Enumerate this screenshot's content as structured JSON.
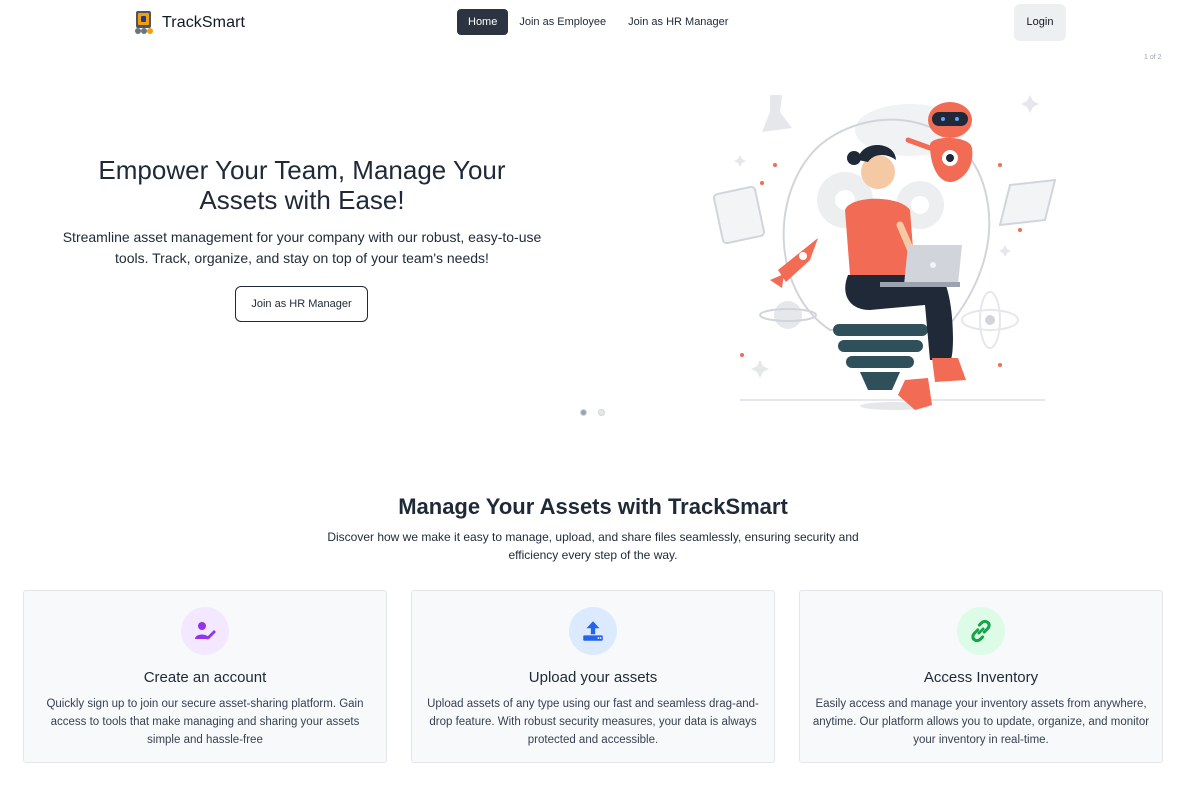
{
  "nav": {
    "brand": "TrackSmart",
    "links": [
      "Home",
      "Join as Employee",
      "Join as HR Manager"
    ],
    "login": "Login"
  },
  "hero": {
    "counter": "1 of 2",
    "title": "Empower Your Team, Manage Your Assets with Ease!",
    "subtitle": "Streamline asset management for your company with our robust, easy-to-use tools. Track, organize, and stay on top of your team's needs!",
    "cta": "Join as HR Manager",
    "illustration": "woman-on-lightbulb-with-robot-illustration"
  },
  "features": {
    "title": "Manage Your Assets with TrackSmart",
    "subtitle": "Discover how we make it easy to manage, upload, and share files seamlessly, ensuring security and efficiency every step of the way.",
    "cards": [
      {
        "icon": "user-edit-icon",
        "title": "Create an account",
        "desc": "Quickly sign up to join our secure asset-sharing platform. Gain access to tools that make managing and sharing your assets simple and hassle-free",
        "bg": "#f3e8ff",
        "fg": "#9333ea"
      },
      {
        "icon": "upload-icon",
        "title": "Upload your assets",
        "desc": "Upload assets of any type using our fast and seamless drag-and-drop feature. With robust security measures, your data is always protected and accessible.",
        "bg": "#dbeafe",
        "fg": "#2563eb"
      },
      {
        "icon": "link-icon",
        "title": "Access Inventory",
        "desc": "Easily access and manage your inventory assets from anywhere, anytime. Our platform allows you to update, organize, and monitor your inventory in real-time.",
        "bg": "#dcfce7",
        "fg": "#16a34a"
      }
    ]
  },
  "colors": {
    "accent": "#2b3440",
    "illustration_accent": "#f26b55"
  }
}
